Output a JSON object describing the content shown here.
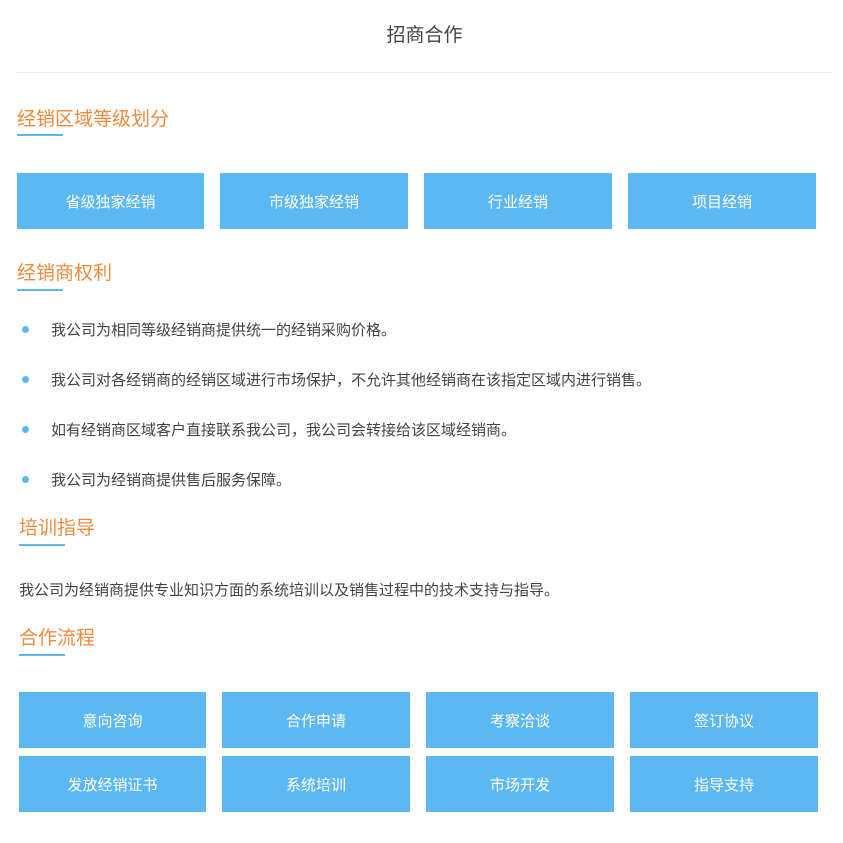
{
  "page_title": "招商合作",
  "sections": {
    "levels": {
      "title": "经销区域等级划分",
      "buttons": [
        "省级独家经销",
        "市级独家经销",
        "行业经销",
        "项目经销"
      ]
    },
    "rights": {
      "title": "经销商权利",
      "items": [
        "我公司为相同等级经销商提供统一的经销采购价格。",
        "我公司对各经销商的经销区域进行市场保护，不允许其他经销商在该指定区域内进行销售。",
        "如有经销商区域客户直接联系我公司，我公司会转接给该区域经销商。",
        "我公司为经销商提供售后服务保障。"
      ]
    },
    "training": {
      "title": "培训指导",
      "text": "我公司为经销商提供专业知识方面的系统培训以及销售过程中的技术支持与指导。"
    },
    "process": {
      "title": "合作流程",
      "steps": [
        "意向咨询",
        "合作申请",
        "考察洽谈",
        "签订协议",
        "发放经销证书",
        "系统培训",
        "市场开发",
        "指导支持"
      ]
    }
  },
  "colors": {
    "accent_orange": "#f08a3c",
    "button_blue": "#5cb8f3",
    "underline_blue": "#5cb8ee"
  }
}
